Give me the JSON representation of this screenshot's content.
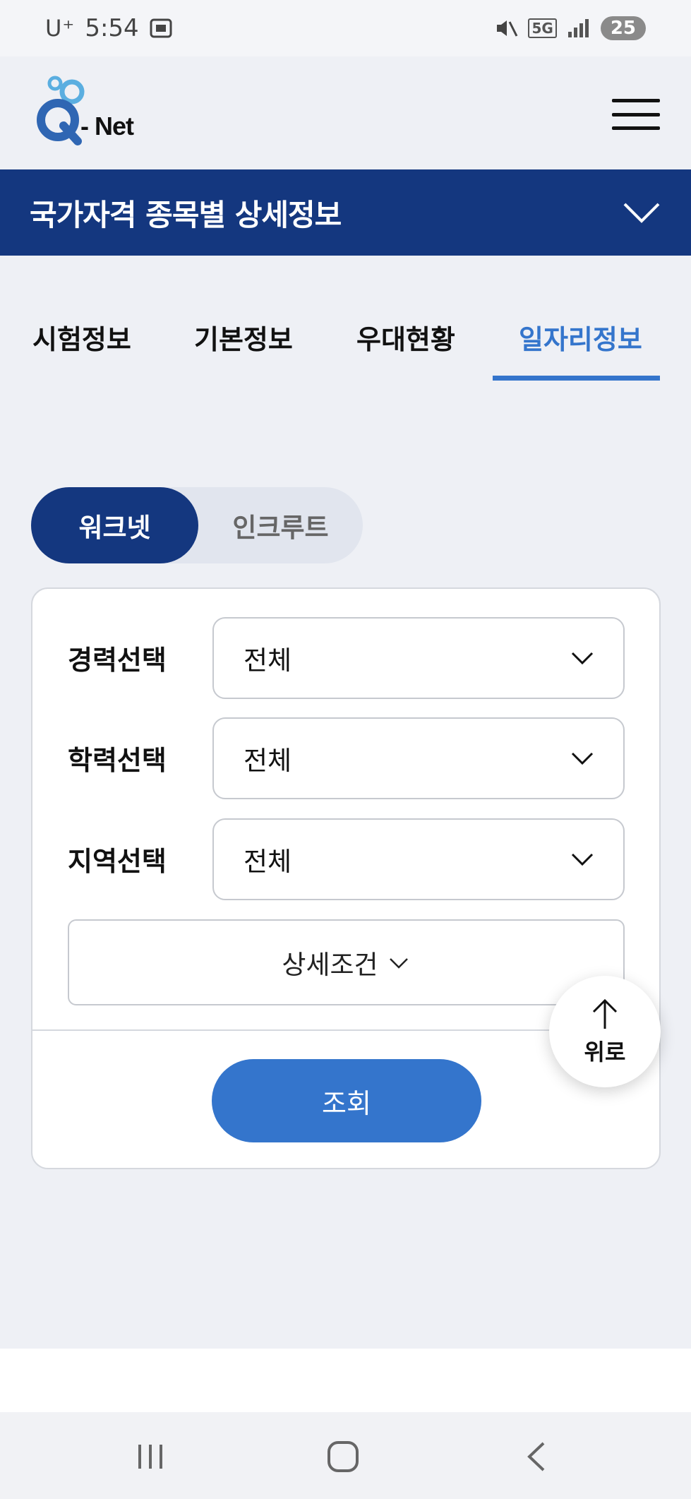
{
  "status_bar": {
    "carrier": "U⁺",
    "time": "5:54",
    "network": "5G",
    "battery": "25"
  },
  "header": {
    "logo_text": "- Net",
    "logo_letter": "Q"
  },
  "title_bar": {
    "title": "국가자격 종목별 상세정보"
  },
  "tabs": [
    {
      "label": "시험정보",
      "active": false
    },
    {
      "label": "기본정보",
      "active": false
    },
    {
      "label": "우대현황",
      "active": false
    },
    {
      "label": "일자리정보",
      "active": true
    }
  ],
  "toggle": {
    "options": [
      "워크넷",
      "인크루트"
    ],
    "selected": "워크넷"
  },
  "filters": [
    {
      "label": "경력선택",
      "value": "전체"
    },
    {
      "label": "학력선택",
      "value": "전체"
    },
    {
      "label": "지역선택",
      "value": "전체"
    }
  ],
  "detail_button": {
    "label": "상세조건"
  },
  "search_button": {
    "label": "조회"
  },
  "top_button": {
    "label": "위로"
  },
  "colors": {
    "brand_navy": "#14377f",
    "accent_blue": "#3475cc",
    "background": "#eef0f5"
  }
}
